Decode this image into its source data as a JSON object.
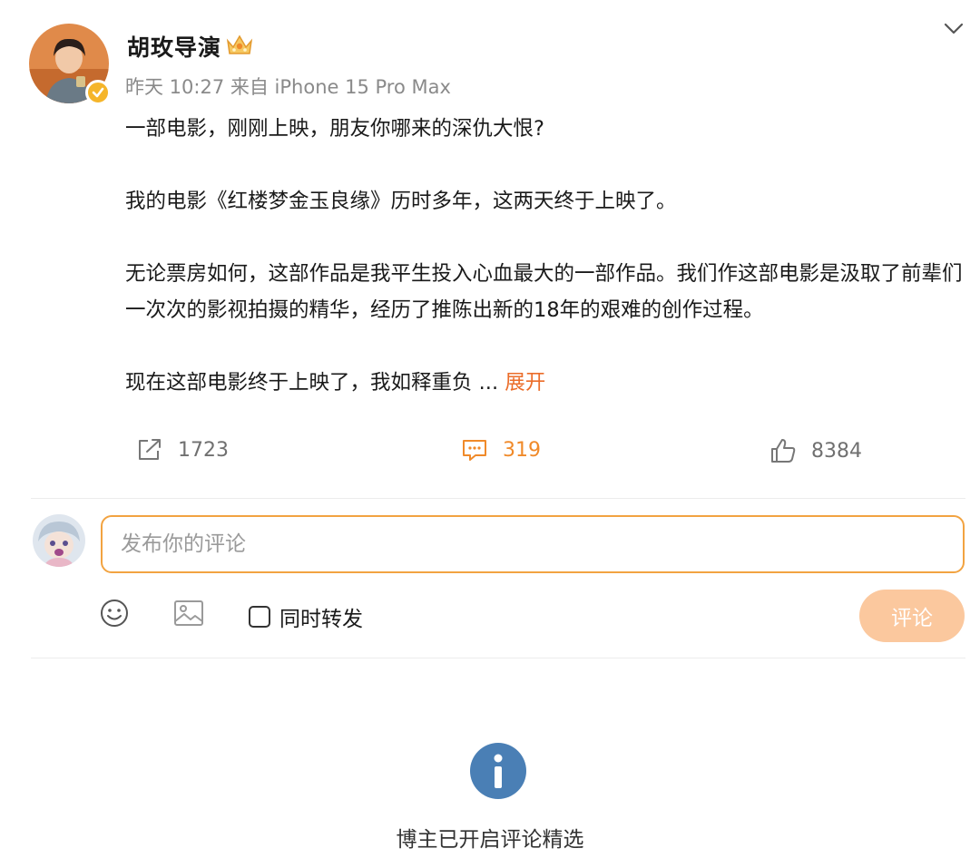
{
  "post": {
    "author": {
      "name": "胡玫导演",
      "avatar_icon": "user-avatar",
      "verified_icon": "verified-badge-icon",
      "badge_icon": "crown-badge-icon"
    },
    "meta": "昨天 10:27 来自 iPhone 15 Pro Max",
    "paragraphs": [
      "一部电影，刚刚上映，朋友你哪来的深仇大恨?",
      "我的电影《红楼梦金玉良缘》历时多年，这两天终于上映了。",
      "无论票房如何，这部作品是我平生投入心血最大的一部作品。我们作这部电影是汲取了前辈们一次次的影视拍摄的精华，经历了推陈出新的18年的艰难的创作过程。",
      "现在这部电影终于上映了，我如释重负 "
    ],
    "ellipsis": "...",
    "expand_label": "展开",
    "actions": {
      "repost": {
        "count": "1723",
        "icon": "share-icon"
      },
      "comment": {
        "count": "319",
        "icon": "comment-icon"
      },
      "like": {
        "count": "8384",
        "icon": "thumbs-up-icon"
      }
    }
  },
  "composer": {
    "placeholder": "发布你的评论",
    "repost_label": "同时转发",
    "submit_label": "评论",
    "emoji_icon": "emoji-icon",
    "image_icon": "image-icon"
  },
  "notice": {
    "text": "博主已开启评论精选",
    "icon": "info-icon"
  },
  "colors": {
    "accent": "#f08a2a",
    "link": "#eb6d2a",
    "submit_disabled": "#fbc89e",
    "info_icon": "#4a7fb5"
  }
}
